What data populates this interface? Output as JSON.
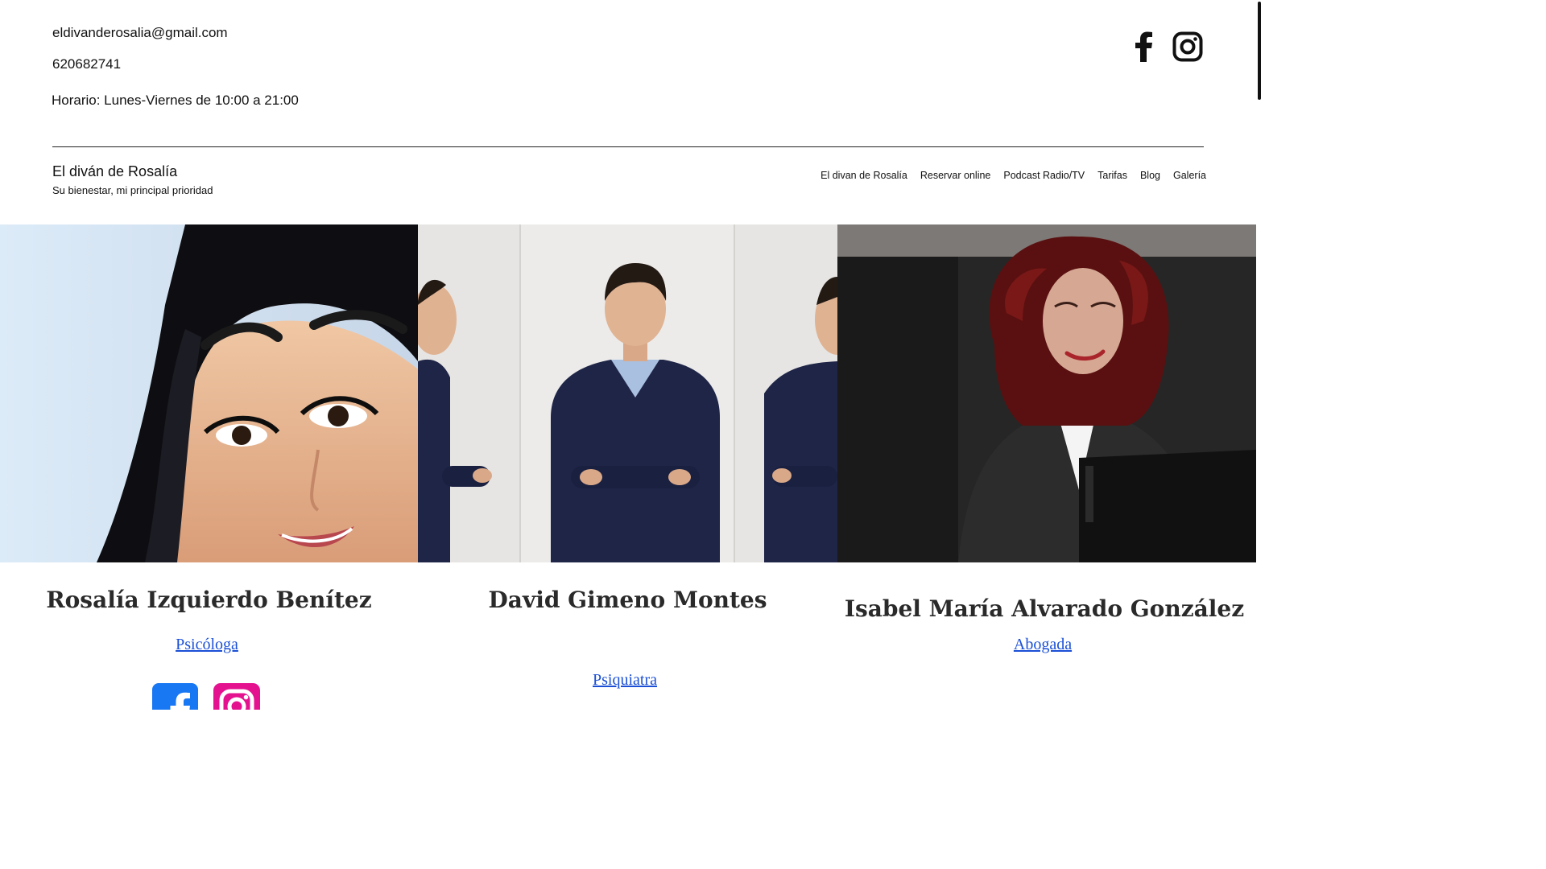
{
  "header": {
    "email": "eldivanderosalia@gmail.com",
    "phone": "620682741",
    "hours": "Horario: Lunes-Viernes de 10:00 a 21:00",
    "site_title": "El diván de Rosalía",
    "tagline": "Su bienestar, mi principal prioridad",
    "social": [
      {
        "icon": "facebook-icon"
      },
      {
        "icon": "instagram-icon"
      }
    ]
  },
  "nav": {
    "items": [
      {
        "label": "El divan de Rosalía"
      },
      {
        "label": "Reservar online"
      },
      {
        "label": "Podcast Radio/TV"
      },
      {
        "label": "Tarifas"
      },
      {
        "label": "Blog"
      },
      {
        "label": "Galería"
      }
    ]
  },
  "team": [
    {
      "name": "Rosalía Izquierdo Benítez",
      "role": "Psicóloga"
    },
    {
      "name": "David Gimeno Montes",
      "role": "Psiquiatra"
    },
    {
      "name": "Isabel María Alvarado González",
      "role": "Abogada"
    }
  ],
  "colors": {
    "link": "#1a4fd6",
    "facebook": "#1877f2",
    "instagram": "#e4128f",
    "sweater": "#1f2547"
  }
}
